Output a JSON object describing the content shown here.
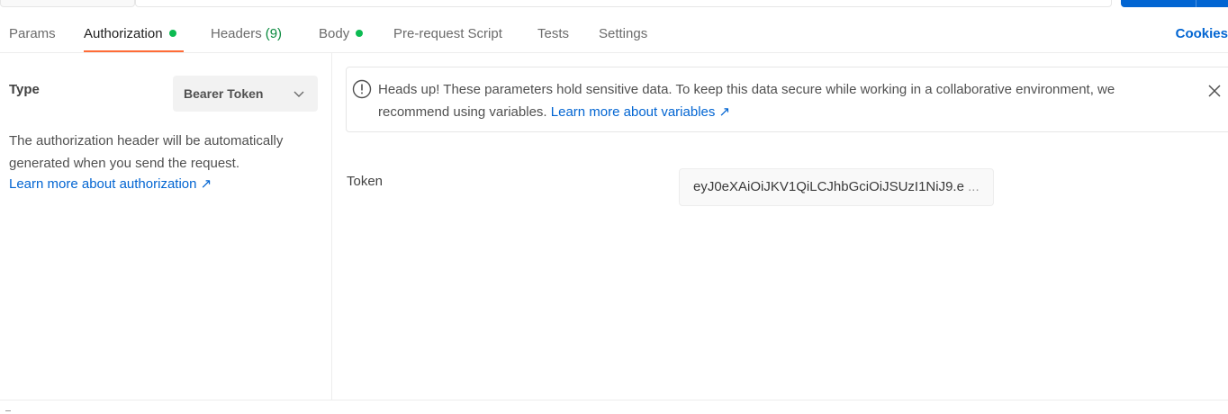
{
  "tabs": [
    {
      "label": "Params"
    },
    {
      "label": "Authorization",
      "dot": true
    },
    {
      "label": "Headers",
      "count": "(9)"
    },
    {
      "label": "Body",
      "dot": true
    },
    {
      "label": "Pre-request Script"
    },
    {
      "label": "Tests"
    },
    {
      "label": "Settings"
    }
  ],
  "cookies_label": "Cookies",
  "auth": {
    "type_label": "Type",
    "type_value": "Bearer Token",
    "description": "The authorization header will be automatically generated when you send the request.",
    "learn_more": "Learn more about authorization ↗"
  },
  "notice": {
    "text": "Heads up! These parameters hold sensitive data. To keep this data secure while working in a collaborative environment, we recommend using variables.",
    "link": "Learn more about variables ↗"
  },
  "token": {
    "label": "Token",
    "value": "eyJ0eXAiOiJKV1QiLCJhbGciOiJSUzI1NiJ9.e",
    "ellipsis": "..."
  },
  "colors": {
    "accent": "#ff6c37",
    "link": "#0265d2",
    "status_dot": "#0cbb52"
  }
}
